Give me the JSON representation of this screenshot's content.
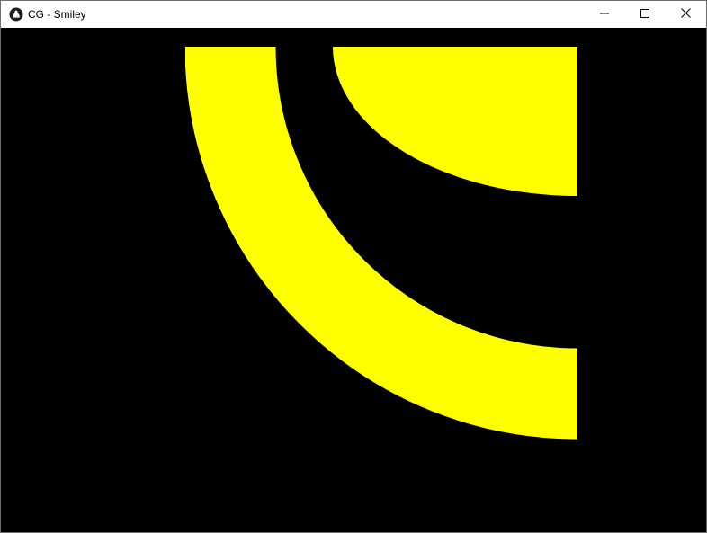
{
  "window": {
    "title": "CG - Smiley",
    "app_icon": "app-logo-icon",
    "controls": {
      "minimize_icon": "minimize-icon",
      "maximize_icon": "maximize-icon",
      "close_icon": "close-icon"
    }
  },
  "canvas": {
    "background_color": "#000000",
    "shape_color": "#ffff00",
    "content": "smiley-fragment"
  }
}
